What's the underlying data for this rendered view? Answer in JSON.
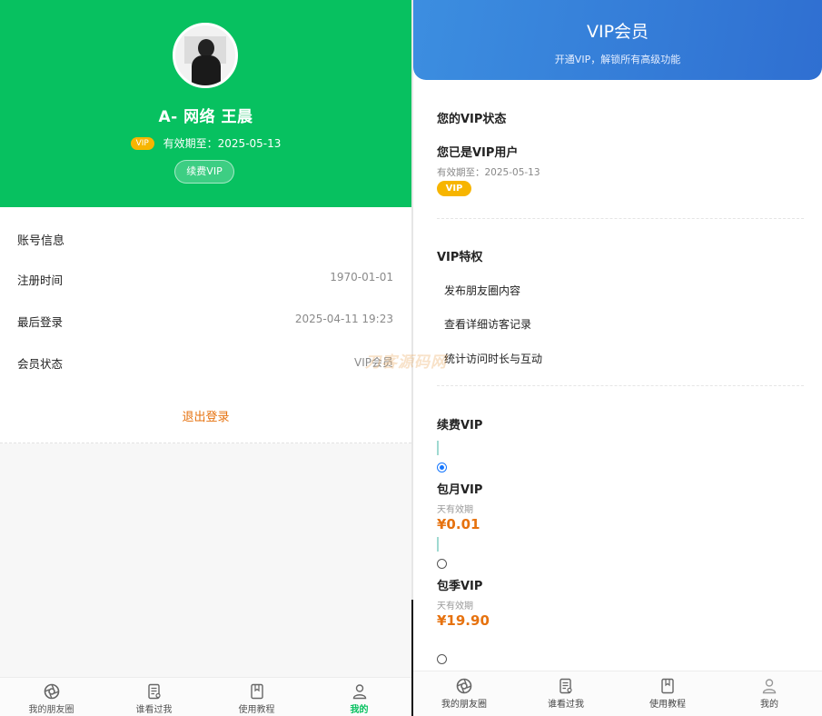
{
  "profile": {
    "name": "A-   网络 王晨",
    "vip_badge": "VIP",
    "expiry": "有效期至：2025-05-13",
    "renew_button": "续费VIP"
  },
  "account": {
    "title": "账号信息",
    "rows": [
      {
        "label": "注册时间",
        "value": "1970-01-01"
      },
      {
        "label": "最后登录",
        "value": "2025-04-11 19:23"
      },
      {
        "label": "会员状态",
        "value": "VIP会员"
      }
    ],
    "logout": "退出登录"
  },
  "tabbar": {
    "items": [
      {
        "label": "我的朋友圈",
        "icon": "aperture-icon"
      },
      {
        "label": "谁看过我",
        "icon": "document-eye-icon"
      },
      {
        "label": "使用教程",
        "icon": "book-icon"
      },
      {
        "label": "我的",
        "icon": "user-icon"
      }
    ],
    "active_color": "#07c160"
  },
  "vip_page": {
    "title": "VIP会员",
    "subtitle": "开通VIP，解锁所有高级功能",
    "status": {
      "title": "您的VIP状态",
      "main": "您已是VIP用户",
      "expiry": "有效期至：2025-05-13",
      "badge": "VIP"
    },
    "privileges": {
      "title": "VIP特权",
      "items": [
        "发布朋友圈内容",
        "查看详细访客记录",
        "统计访问时长与互动"
      ]
    },
    "renew": {
      "title": "续费VIP",
      "plans": [
        {
          "name": "包月VIP",
          "desc": "天有效期",
          "price": "¥0.01",
          "selected": true
        },
        {
          "name": "包季VIP",
          "desc": "天有效期",
          "price": "¥19.90",
          "selected": false
        }
      ]
    }
  },
  "watermark": "刀客源码网",
  "colors": {
    "green": "#07c160",
    "blue": "#3c8ee0",
    "orange": "#e6720f",
    "gold": "#f7b500"
  }
}
